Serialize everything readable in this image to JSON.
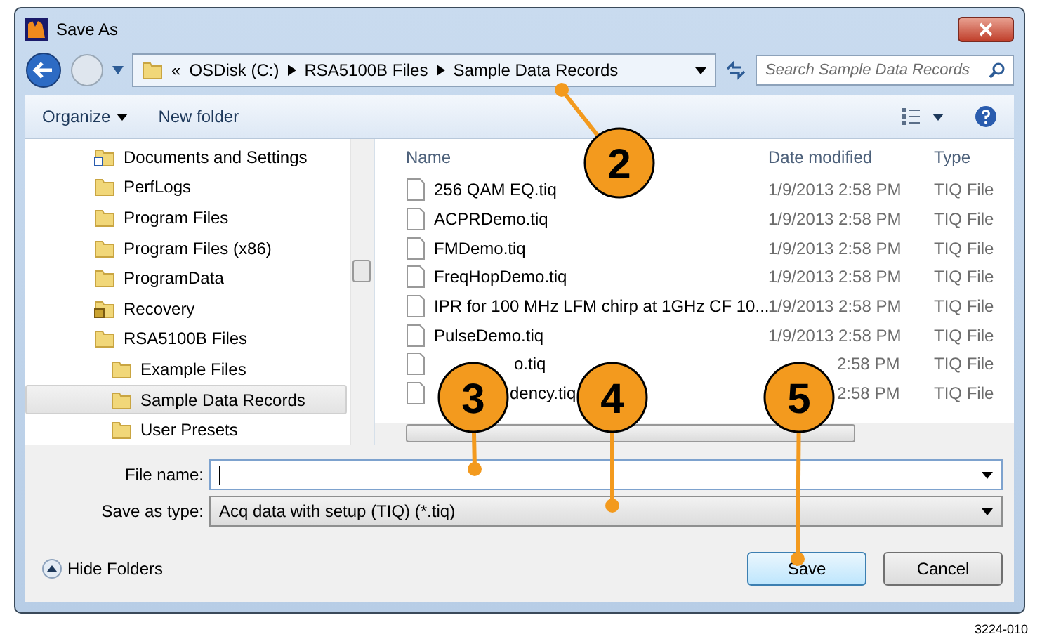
{
  "window": {
    "title": "Save As"
  },
  "address": {
    "overflow": "«",
    "crumbs": [
      "OSDisk (C:)",
      "RSA5100B Files",
      "Sample Data Records"
    ]
  },
  "search": {
    "placeholder": "Search Sample Data Records"
  },
  "toolbar": {
    "organize": "Organize",
    "new_folder": "New folder"
  },
  "tree": [
    {
      "name": "Documents and Settings",
      "kind": "shortcut",
      "selected": false
    },
    {
      "name": "PerfLogs",
      "kind": "folder",
      "selected": false
    },
    {
      "name": "Program Files",
      "kind": "folder",
      "selected": false
    },
    {
      "name": "Program Files (x86)",
      "kind": "folder",
      "selected": false
    },
    {
      "name": "ProgramData",
      "kind": "folder",
      "selected": false
    },
    {
      "name": "Recovery",
      "kind": "locked",
      "selected": false
    },
    {
      "name": "RSA5100B Files",
      "kind": "folder",
      "selected": false,
      "children": [
        {
          "name": "Example Files",
          "kind": "folder",
          "selected": false
        },
        {
          "name": "Sample Data Records",
          "kind": "folder",
          "selected": true
        },
        {
          "name": "User Presets",
          "kind": "folder",
          "selected": false
        }
      ]
    }
  ],
  "table": {
    "columns": [
      "Name",
      "Date modified",
      "Type"
    ],
    "rows": [
      {
        "name": "256 QAM EQ.tiq",
        "date": "1/9/2013 2:58 PM",
        "type": "TIQ File"
      },
      {
        "name": "ACPRDemo.tiq",
        "date": "1/9/2013 2:58 PM",
        "type": "TIQ File"
      },
      {
        "name": "FMDemo.tiq",
        "date": "1/9/2013 2:58 PM",
        "type": "TIQ File"
      },
      {
        "name": "FreqHopDemo.tiq",
        "date": "1/9/2013 2:58 PM",
        "type": "TIQ File"
      },
      {
        "name": "IPR for 100 MHz LFM chirp at 1GHz CF 10...",
        "date": "1/9/2013 2:58 PM",
        "type": "TIQ File"
      },
      {
        "name": "PulseDemo.tiq",
        "date": "1/9/2013 2:58 PM",
        "type": "TIQ File"
      },
      {
        "name": "o.tiq",
        "date": "2:58 PM",
        "type": "TIQ File"
      },
      {
        "name": "dency.tiq",
        "date": "2:58 PM",
        "type": "TIQ File"
      }
    ]
  },
  "file_name": {
    "label": "File name:"
  },
  "save_as_type": {
    "label": "Save as type:",
    "value": "Acq data with setup (TIQ) (*.tiq)"
  },
  "hide_folders": "Hide Folders",
  "buttons": [
    "Save",
    "Cancel"
  ],
  "callouts": [
    {
      "label": "2"
    },
    {
      "label": "3"
    },
    {
      "label": "4"
    },
    {
      "label": "5"
    }
  ],
  "figure_id": "3224-010"
}
